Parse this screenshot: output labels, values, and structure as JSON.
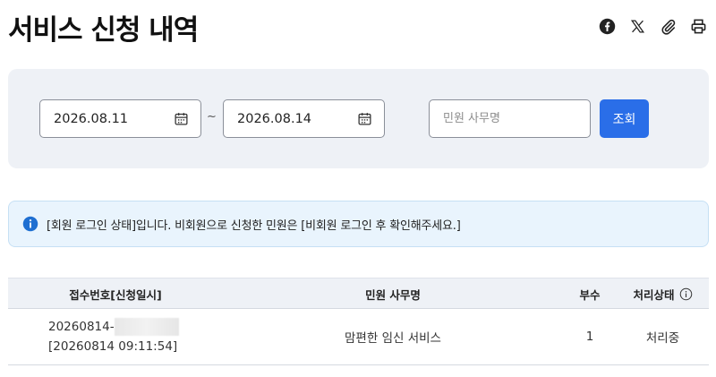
{
  "page": {
    "title": "서비스 신청 내역"
  },
  "share": {
    "icons": [
      "facebook-icon",
      "x-icon",
      "paperclip-icon",
      "print-icon"
    ]
  },
  "search": {
    "start_date": "2026.08.11",
    "end_date": "2026.08.14",
    "separator": "~",
    "keyword_placeholder": "민원 사무명",
    "keyword_value": "",
    "search_label": "조회"
  },
  "notice": {
    "message": "[회원 로그인 상태]입니다. 비회원으로 신청한 민원은 [비회원 로그인 후 확인해주세요.]"
  },
  "table": {
    "headers": {
      "receipt": "접수번호[신청일시]",
      "service": "민원 사무명",
      "copies": "부수",
      "status": "처리상태"
    },
    "rows": [
      {
        "receipt_prefix": "20260814-",
        "receipt_datetime": "[20260814 09:11:54]",
        "service": "맘편한 임신 서비스",
        "copies": "1",
        "status": "처리중"
      }
    ]
  },
  "colors": {
    "accent": "#2a6ee8",
    "panel_bg": "#eef1f6",
    "info_bg": "#e9f4fd",
    "info_icon": "#1f6fd1"
  }
}
